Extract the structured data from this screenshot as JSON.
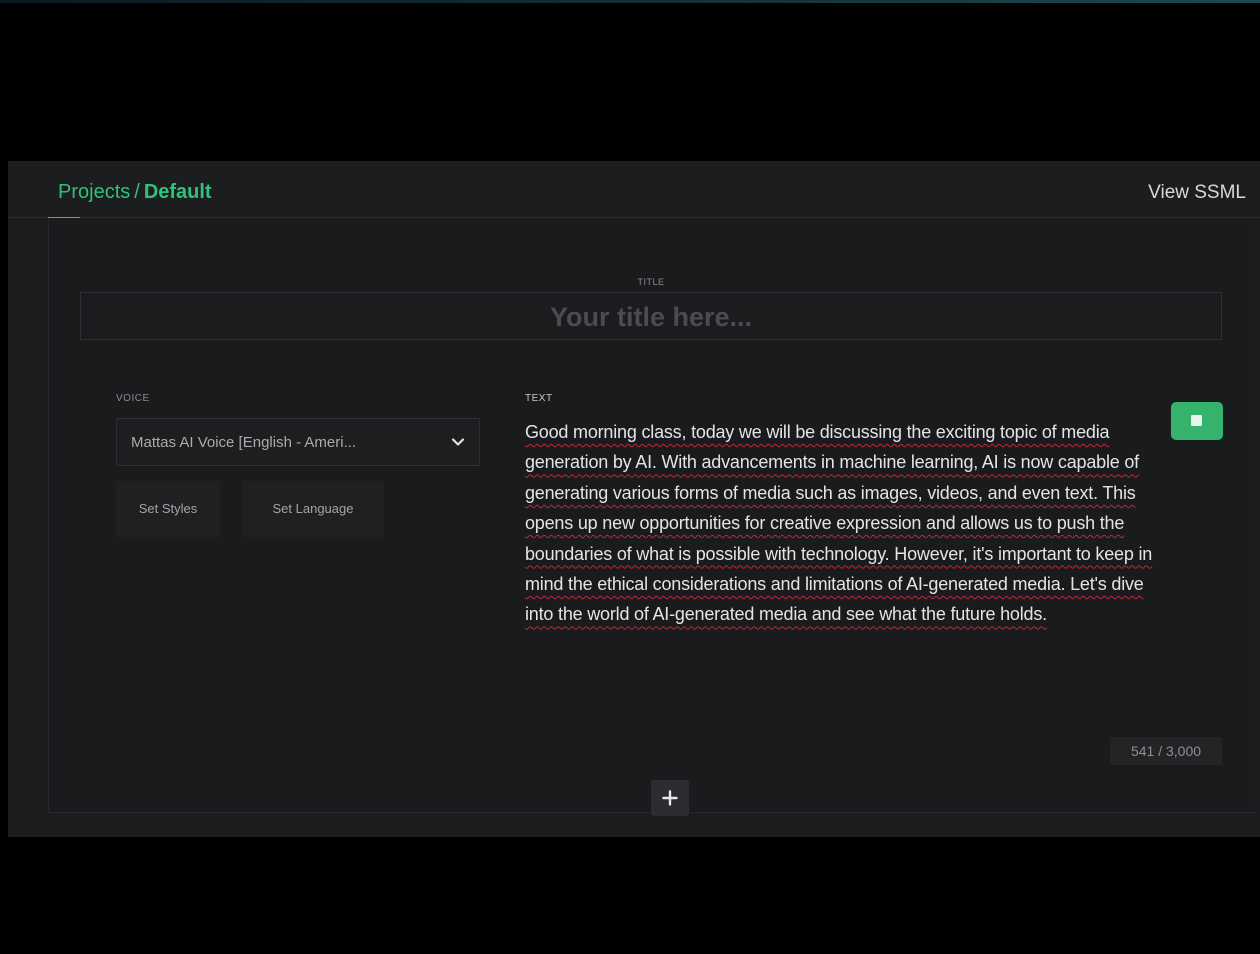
{
  "header": {
    "breadcrumb_parent": "Projects",
    "breadcrumb_separator": "/",
    "breadcrumb_current": "Default",
    "view_ssml_label": "View SSML"
  },
  "title_field": {
    "label": "TITLE",
    "placeholder": "Your title here..."
  },
  "voice": {
    "label": "VOICE",
    "selected_value": "Mattas AI Voice [English - Ameri...",
    "set_styles_label": "Set Styles",
    "set_language_label": "Set Language"
  },
  "text_block": {
    "label": "TEXT",
    "content": "Good morning class, today we will be discussing the exciting topic of media generation by AI. With advancements in machine learning, AI is now capable of generating various forms of media such as images, videos, and even text. This opens up new opportunities for creative expression and allows us to push the boundaries of what is possible with technology. However, it's important to keep in mind the ethical considerations and limitations of AI-generated media. Let's dive into the world of AI-generated media and see what the future holds.",
    "char_count": "541 / 3,000"
  },
  "icons": {
    "stop": "stop-icon",
    "add": "plus-icon",
    "dropdown": "chevron-down-icon"
  },
  "colors": {
    "accent_green": "#2fc27a",
    "button_green": "#35b36c",
    "spellcheck_red": "#c0283a",
    "panel_bg": "#1c1d1f"
  }
}
